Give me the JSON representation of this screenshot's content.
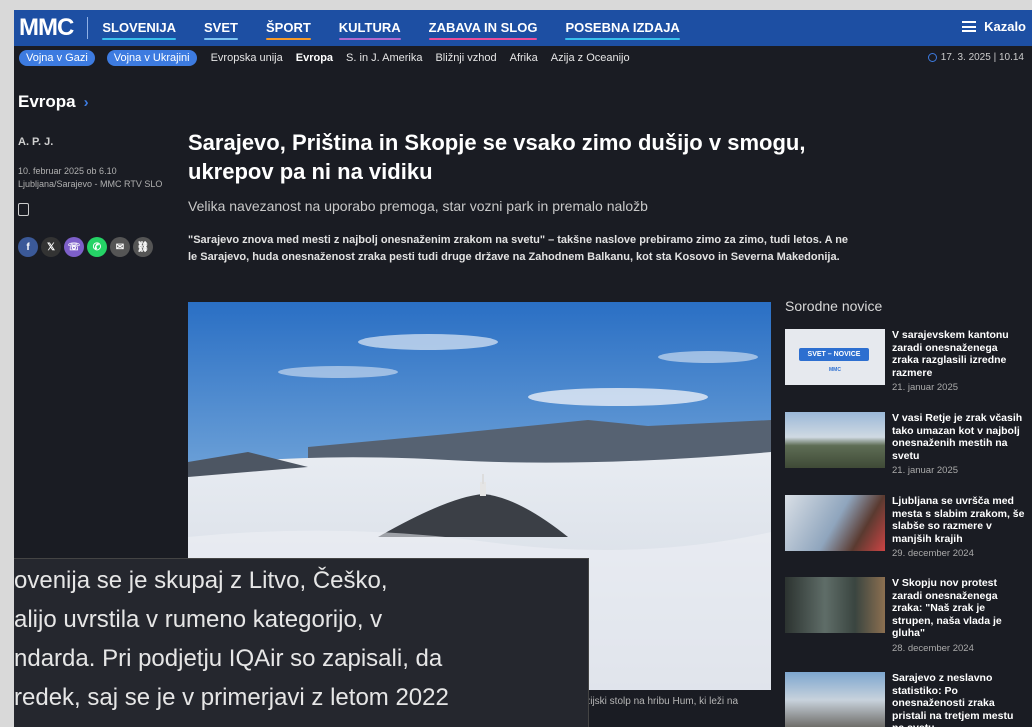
{
  "header": {
    "logo": "MMC",
    "nav": [
      {
        "label": "SLOVENIJA",
        "underline": "#39c0ed"
      },
      {
        "label": "SVET",
        "underline": "#7ec4f2"
      },
      {
        "label": "ŠPORT",
        "underline": "#f59a2a"
      },
      {
        "label": "KULTURA",
        "underline": "#b06ad0"
      },
      {
        "label": "ZABAVA IN SLOG",
        "underline": "#ec4d9a"
      },
      {
        "label": "POSEBNA IZDAJA",
        "underline": "#39c0ed"
      }
    ],
    "menu_label": "Kazalo"
  },
  "subnav": {
    "pills": [
      "Vojna v Gazi",
      "Vojna v Ukrajini"
    ],
    "links": [
      "Evropska unija",
      "Evropa",
      "S. in J. Amerika",
      "Bližnji vzhod",
      "Afrika",
      "Azija z Oceanijo"
    ],
    "active": "Evropa",
    "datetime": "17. 3. 2025 | 10.14"
  },
  "article": {
    "section": "Evropa",
    "author": "A. P. J.",
    "date": "10. februar 2025 ob 6.10",
    "location": "Ljubljana/Sarajevo - MMC RTV SLO",
    "title": "Sarajevo, Priština in Skopje se vsako zimo dušijo v smogu, ukrepov pa ni na vidiku",
    "subtitle": "Velika navezanost na uporabo premoga, star vozni park in premalo naložb",
    "lead": "\"Sarajevo znova med mesti z najbolj onesnaženim zrakom na svetu\" – takšne naslove prebiramo zimo za zimo, tudi letos. A ne le Sarajevo, huda onesnaženost zraka pesti tudi druge države na Zahodnem Balkanu, kot sta Kosovo in Severna Makedonija.",
    "caption": "vizijski stolp na hribu Hum, ki leži na"
  },
  "share": [
    {
      "icon": "facebook-icon",
      "glyph": "f",
      "color": "#3b5998"
    },
    {
      "icon": "x-icon",
      "glyph": "𝕏",
      "color": "#333333"
    },
    {
      "icon": "viber-icon",
      "glyph": "☏",
      "color": "#7d5fc9"
    },
    {
      "icon": "whatsapp-icon",
      "glyph": "✆",
      "color": "#25d366"
    },
    {
      "icon": "email-icon",
      "glyph": "✉",
      "color": "#555555"
    },
    {
      "icon": "link-icon",
      "glyph": "⛓",
      "color": "#555555"
    }
  ],
  "related": {
    "heading": "Sorodne novice",
    "items": [
      {
        "title": "V sarajevskem kantonu zaradi onesnaženega zraka razglasili izredne razmere",
        "date": "21. januar 2025",
        "thumb_label": "SVET – NOVICE",
        "thumb_logo": "MMC"
      },
      {
        "title": "V vasi Retje je zrak včasih tako umazan kot v najbolj onesnaženih mestih na svetu",
        "date": "21. januar 2025"
      },
      {
        "title": "Ljubljana se uvršča med mesta s slabim zrakom, še slabše so razmere v manjših krajih",
        "date": "29. december 2024"
      },
      {
        "title": "V Skopju nov protest zaradi onesnaženega zraka: \"Naš zrak je strupen, naša vlada je gluha\"",
        "date": "28. december 2024"
      },
      {
        "title": "Sarajevo z neslavno statistiko: Po onesnaženosti zraka pristali na tretjem mestu na svetu",
        "date": ""
      }
    ]
  },
  "zoom": {
    "lines": [
      "ovenija se je skupaj z Litvo, Češko,",
      "alijo uvrstila v rumeno kategorijo, v",
      "ndarda. Pri podjetju IQAir so zapisali, da",
      "redek, saj se je v primerjavi z letom 2022"
    ]
  }
}
